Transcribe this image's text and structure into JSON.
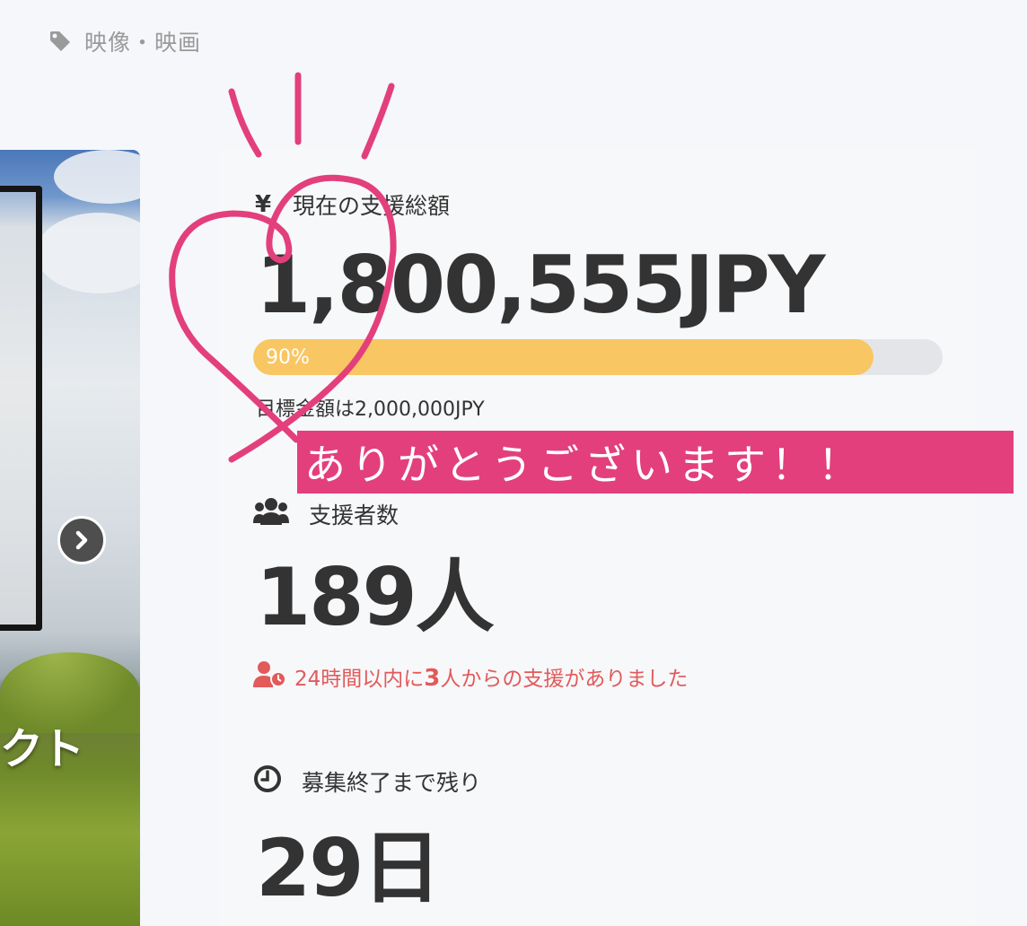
{
  "category": {
    "icon": "tag-icon",
    "label": "映像・映画"
  },
  "hero": {
    "overlay_text": "クト",
    "next_icon": "chevron-right-icon"
  },
  "funding": {
    "icon": "yen-icon",
    "icon_glyph": "¥",
    "label": "現在の支援総額",
    "amount": "1,800,555JPY",
    "progress_percent": 90,
    "progress_label": "90%",
    "goal_text": "目標金額は2,000,000JPY"
  },
  "backers": {
    "icon": "users-icon",
    "label": "支援者数",
    "count": "189人",
    "recent_icon": "user-clock-icon",
    "recent_prefix": "24時間以内に",
    "recent_num": "3",
    "recent_suffix": "人からの支援がありました"
  },
  "remaining": {
    "icon": "clock-icon",
    "label": "募集終了まで残り",
    "days": "29日"
  },
  "annotation": {
    "banner_text": "ありがとうございます！！",
    "color": "#e33f7c"
  },
  "colors": {
    "progress": "#f8c662",
    "recent": "#e25a5a",
    "track": "#e4e5e8"
  }
}
